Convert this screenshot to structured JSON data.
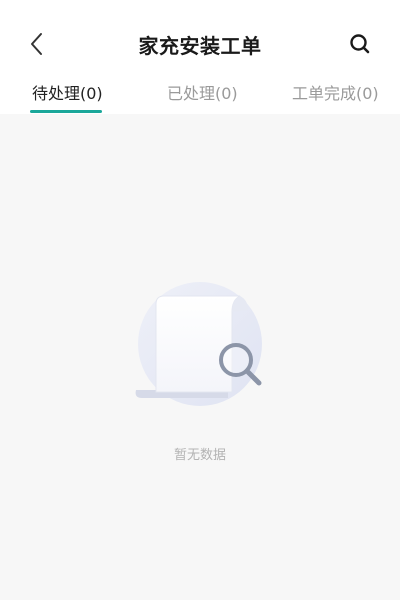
{
  "header": {
    "title": "家充安装工单",
    "back_icon": "chevron-left-icon",
    "search_icon": "search-icon"
  },
  "tabs": [
    {
      "label": "待处理(0)",
      "active": true
    },
    {
      "label": "已处理(0)",
      "active": false
    },
    {
      "label": "工单完成(0)",
      "active": false
    }
  ],
  "colors": {
    "accent": "#1aa79a",
    "background": "#f7f7f7"
  },
  "empty_state": {
    "icon": "empty-document-search-illustration",
    "text": "暂无数据"
  }
}
